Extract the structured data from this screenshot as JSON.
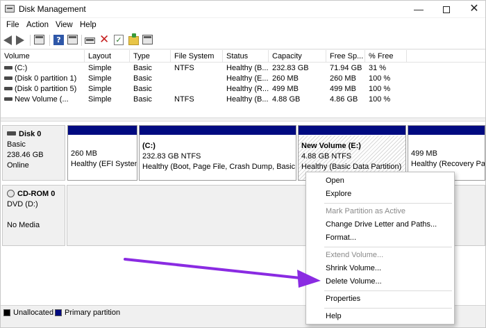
{
  "window": {
    "title": "Disk Management",
    "icon": "disk-management-icon",
    "min_glyph": "—",
    "close_glyph": "✕"
  },
  "menu": {
    "items": [
      "File",
      "Action",
      "View",
      "Help"
    ]
  },
  "toolbar": {
    "icons": [
      "back-arrow-icon",
      "forward-arrow-icon",
      "show-hide-console-tree-icon",
      "help-icon",
      "properties-icon",
      "connect-drive-icon",
      "delete-icon",
      "checklist-icon",
      "folder-icon",
      "console-icon"
    ],
    "glyphs": {
      "help": "?",
      "delete": "✕",
      "check": "✓"
    }
  },
  "table": {
    "columns": [
      "Volume",
      "Layout",
      "Type",
      "File System",
      "Status",
      "Capacity",
      "Free Sp...",
      "% Free"
    ],
    "rows": [
      [
        "(C:)",
        "Simple",
        "Basic",
        "NTFS",
        "Healthy (B...",
        "232.83 GB",
        "71.94 GB",
        "31 %"
      ],
      [
        "(Disk 0 partition 1)",
        "Simple",
        "Basic",
        "",
        "Healthy (E...",
        "260 MB",
        "260 MB",
        "100 %"
      ],
      [
        "(Disk 0 partition 5)",
        "Simple",
        "Basic",
        "",
        "Healthy (R...",
        "499 MB",
        "499 MB",
        "100 %"
      ],
      [
        "New Volume (...",
        "Simple",
        "Basic",
        "NTFS",
        "Healthy (B...",
        "4.88 GB",
        "4.86 GB",
        "100 %"
      ]
    ]
  },
  "disks": [
    {
      "name": "Disk 0",
      "type": "Basic",
      "size": "238.46 GB",
      "status": "Online",
      "partitions": [
        {
          "title": "",
          "size_fs": "260 MB",
          "status": "Healthy (EFI System"
        },
        {
          "title": "(C:)",
          "size_fs": "232.83 GB NTFS",
          "status": "Healthy (Boot, Page File, Crash Dump, Basic Da"
        },
        {
          "title": "New Volume  (E:)",
          "size_fs": "4.88 GB NTFS",
          "status": "Healthy (Basic Data Partition)"
        },
        {
          "title": "",
          "size_fs": "499 MB",
          "status": "Healthy (Recovery Part"
        }
      ]
    },
    {
      "name": "CD-ROM 0",
      "type": "DVD (D:)",
      "size": "",
      "status": "No Media"
    }
  ],
  "legend": [
    {
      "label": "Unallocated",
      "color": "#000000"
    },
    {
      "label": "Primary partition",
      "color": "#000a80"
    }
  ],
  "context_menu": {
    "items": [
      {
        "label": "Open",
        "enabled": true
      },
      {
        "label": "Explore",
        "enabled": true
      },
      {
        "label": "Mark Partition as Active",
        "enabled": false
      },
      {
        "label": "Change Drive Letter and Paths...",
        "enabled": true
      },
      {
        "label": "Format...",
        "enabled": true
      },
      {
        "label": "Extend Volume...",
        "enabled": false
      },
      {
        "label": "Shrink Volume...",
        "enabled": true
      },
      {
        "label": "Delete Volume...",
        "enabled": true
      },
      {
        "label": "Properties",
        "enabled": true
      },
      {
        "label": "Help",
        "enabled": true
      }
    ]
  },
  "colors": {
    "partition_bar": "#000a80",
    "annotation_arrow": "#8a2be2"
  }
}
